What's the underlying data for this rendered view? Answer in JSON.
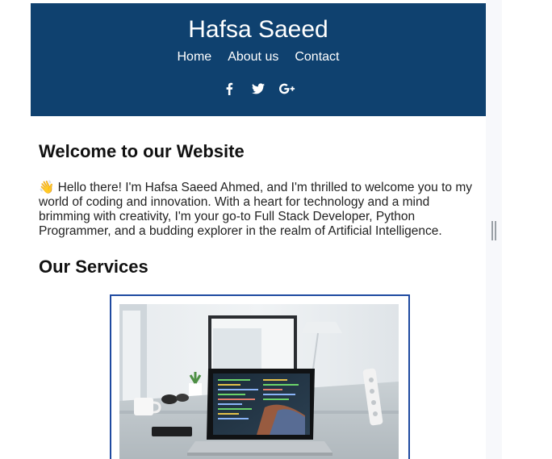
{
  "header": {
    "title": "Hafsa Saeed",
    "nav": [
      "Home",
      "About us",
      "Contact"
    ],
    "social_icons": [
      "facebook-icon",
      "twitter-icon",
      "google-plus-icon"
    ],
    "bg_color": "#0f416f"
  },
  "main": {
    "welcome_heading": "Welcome to our Website",
    "intro_emoji": "👋",
    "intro_text": "Hello there! I'm Hafsa Saeed Ahmed, and I'm thrilled to welcome you to my world of coding and innovation. With a heart for technology and a mind brimming with creativity, I'm your go-to Full Stack Developer, Python Programmer, and a budding explorer in the realm of Artificial Intelligence.",
    "services_heading": "Our Services",
    "service_card_border": "#1f4aa0"
  }
}
